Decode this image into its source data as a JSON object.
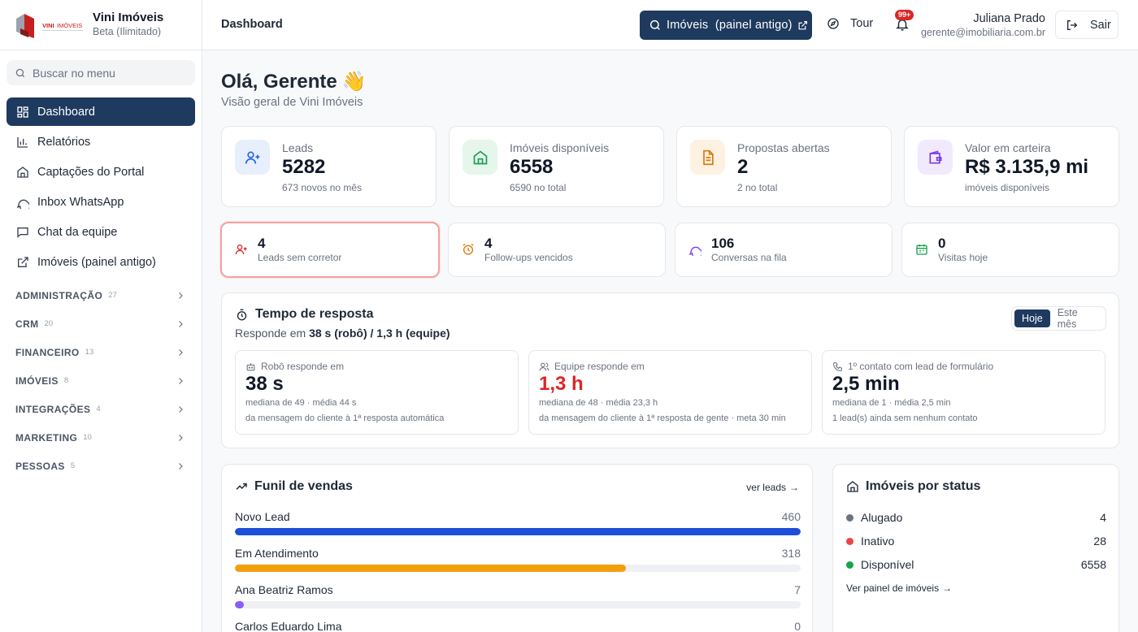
{
  "brand": {
    "name": "Vini Imóveis",
    "subtitle": "Beta (Ilimitado)",
    "logo_text": "VINI IMÓVEIS"
  },
  "sidebar": {
    "search_placeholder": "Buscar no menu",
    "items": [
      {
        "label": "Dashboard",
        "icon": "dashboard-icon",
        "active": true
      },
      {
        "label": "Relatórios",
        "icon": "bar-chart-icon"
      },
      {
        "label": "Captações do Portal",
        "icon": "home-icon"
      },
      {
        "label": "Inbox WhatsApp",
        "icon": "chat-bubble-icon"
      },
      {
        "label": "Chat da equipe",
        "icon": "message-square-icon"
      },
      {
        "label": "Imóveis (painel antigo)",
        "icon": "external-link-icon"
      }
    ],
    "groups": [
      {
        "label": "ADMINISTRAÇÃO",
        "count": "27"
      },
      {
        "label": "CRM",
        "count": "20"
      },
      {
        "label": "FINANCEIRO",
        "count": "13"
      },
      {
        "label": "IMÓVEIS",
        "count": "8"
      },
      {
        "label": "INTEGRAÇÕES",
        "count": "4"
      },
      {
        "label": "MARKETING",
        "count": "10"
      },
      {
        "label": "PESSOAS",
        "count": "5"
      }
    ]
  },
  "header": {
    "title": "Dashboard",
    "legacy_button": "Imóveis  (painel antigo)",
    "tour": "Tour",
    "notif_badge": "99+",
    "user_name": "Juliana Prado",
    "user_email": "gerente@imobiliaria.com.br",
    "logout": "Sair"
  },
  "greeting": {
    "title": "Olá, Gerente",
    "emoji": "👋",
    "subtitle": "Visão geral de Vini Imóveis"
  },
  "stats": [
    {
      "label": "Leads",
      "value": "5282",
      "sub": "673 novos no mês",
      "icon": "user-plus-icon",
      "color": "#2563eb",
      "bg": "#e8effc"
    },
    {
      "label": "Imóveis disponíveis",
      "value": "6558",
      "sub": "6590 no total",
      "icon": "home-icon",
      "color": "#16a34a",
      "bg": "#e6f6ec"
    },
    {
      "label": "Propostas abertas",
      "value": "2",
      "sub": "2 no total",
      "icon": "document-icon",
      "color": "#d97706",
      "bg": "#fdf2e1"
    },
    {
      "label": "Valor em carteira",
      "value": "R$ 3.135,9 mi",
      "sub": "imóveis disponíveis",
      "icon": "wallet-icon",
      "color": "#7c3aed",
      "bg": "#f1eafd"
    }
  ],
  "mini": [
    {
      "value": "4",
      "label": "Leads sem corretor",
      "icon": "user-plus-icon",
      "color": "#dc2626"
    },
    {
      "value": "4",
      "label": "Follow-ups vencidos",
      "icon": "alarm-clock-icon",
      "color": "#d97706"
    },
    {
      "value": "106",
      "label": "Conversas na fila",
      "icon": "chat-bubble-icon",
      "color": "#7c3aed"
    },
    {
      "value": "0",
      "label": "Visitas hoje",
      "icon": "calendar-icon",
      "color": "#16a34a"
    }
  ],
  "response": {
    "title": "Tempo de resposta",
    "subtitle_prefix": "Responde em ",
    "subtitle_bold": "38 s (robô) / 1,3 h (equipe)",
    "seg_today": "Hoje",
    "seg_month": "Este mês",
    "cards": [
      {
        "head": "Robô responde em",
        "value": "38 s",
        "line1": "mediana de 49 · média 44 s",
        "line2": "da mensagem do cliente à 1ª resposta automática",
        "icon": "robot-icon"
      },
      {
        "head": "Equipe responde em",
        "value": "1,3 h",
        "line1": "mediana de 48 · média 23,3 h",
        "line2": "da mensagem do cliente à 1ª resposta de gente · meta 30 min",
        "icon": "users-icon"
      },
      {
        "head": "1º contato com lead de formulário",
        "value": "2,5 min",
        "line1": "mediana de 1 · média 2,5 min",
        "line2": "1 lead(s) ainda sem nenhum contato",
        "icon": "phone-icon"
      }
    ]
  },
  "funnel": {
    "title": "Funil de vendas",
    "link": "ver leads",
    "max": 460,
    "rows": [
      {
        "name": "Novo Lead",
        "value": 460,
        "color": "#1d4ed8"
      },
      {
        "name": "Em Atendimento",
        "value": 318,
        "color": "#f59e0b"
      },
      {
        "name": "Ana Beatriz Ramos",
        "value": 7,
        "color": "#8b5cf6"
      },
      {
        "name": "Carlos Eduardo Lima",
        "value": 0,
        "color": "#10b981"
      }
    ]
  },
  "status": {
    "title": "Imóveis por status",
    "rows": [
      {
        "name": "Alugado",
        "value": "4",
        "color": "#6b7280"
      },
      {
        "name": "Inativo",
        "value": "28",
        "color": "#ef4444"
      },
      {
        "name": "Disponível",
        "value": "6558",
        "color": "#16a34a"
      }
    ],
    "link": "Ver painel de imóveis"
  }
}
